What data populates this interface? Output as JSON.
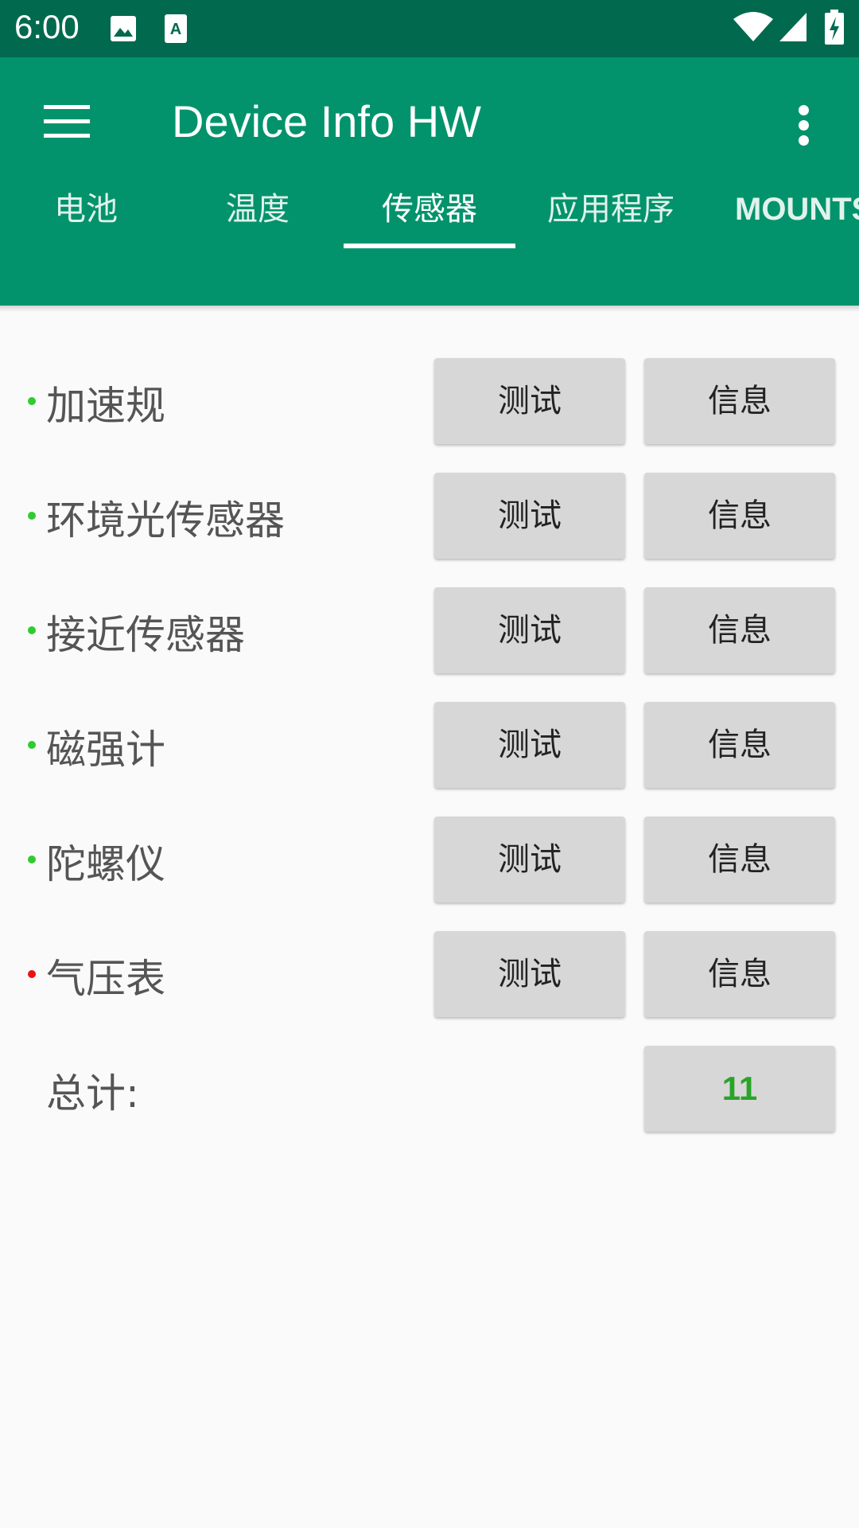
{
  "status_bar": {
    "time": "6:00",
    "icons": [
      "image-icon",
      "font-icon",
      "wifi-icon",
      "signal-icon",
      "battery-charging-icon"
    ]
  },
  "app_bar": {
    "title": "Device Info HW",
    "menu_icon": "hamburger-menu-icon",
    "overflow_icon": "more-vert-icon"
  },
  "tabs": [
    {
      "label": "电池"
    },
    {
      "label": "温度"
    },
    {
      "label": "传感器",
      "active": true
    },
    {
      "label": "应用程序"
    },
    {
      "label": "MOUNTS"
    }
  ],
  "sensors": [
    {
      "label": "加速规",
      "status_color": "#2ecc2e",
      "test_label": "测试",
      "info_label": "信息"
    },
    {
      "label": "环境光传感器",
      "status_color": "#2ecc2e",
      "test_label": "测试",
      "info_label": "信息"
    },
    {
      "label": "接近传感器",
      "status_color": "#2ecc2e",
      "test_label": "测试",
      "info_label": "信息"
    },
    {
      "label": "磁强计",
      "status_color": "#2ecc2e",
      "test_label": "测试",
      "info_label": "信息"
    },
    {
      "label": "陀螺仪",
      "status_color": "#2ecc2e",
      "test_label": "测试",
      "info_label": "信息"
    },
    {
      "label": "气压表",
      "status_color": "#ee1111",
      "test_label": "测试",
      "info_label": "信息"
    }
  ],
  "total": {
    "label": "总计:",
    "value": "11",
    "value_color": "#28a428"
  },
  "colors": {
    "primary": "#03936c",
    "primary_dark": "#00694e",
    "background": "#fafafa"
  }
}
